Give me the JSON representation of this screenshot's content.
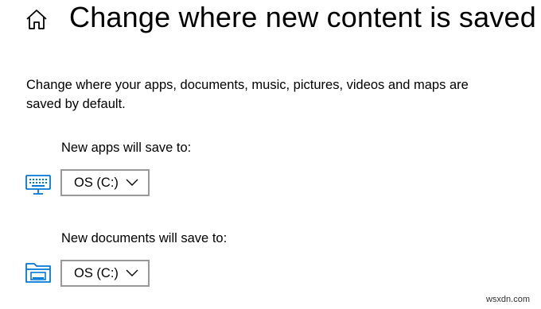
{
  "header": {
    "title": "Change where new content is saved",
    "home_icon": "home-icon"
  },
  "description": "Change where your apps, documents, music, pictures, videos and maps are saved by default.",
  "sections": [
    {
      "label": "New apps will save to:",
      "icon": "monitor-keyboard-icon",
      "selected": "OS (C:)"
    },
    {
      "label": "New documents will save to:",
      "icon": "folder-drive-icon",
      "selected": "OS (C:)"
    }
  ],
  "watermark": "wsxdn.com",
  "colors": {
    "accent": "#0078d7",
    "dropdown_border": "#999999"
  }
}
